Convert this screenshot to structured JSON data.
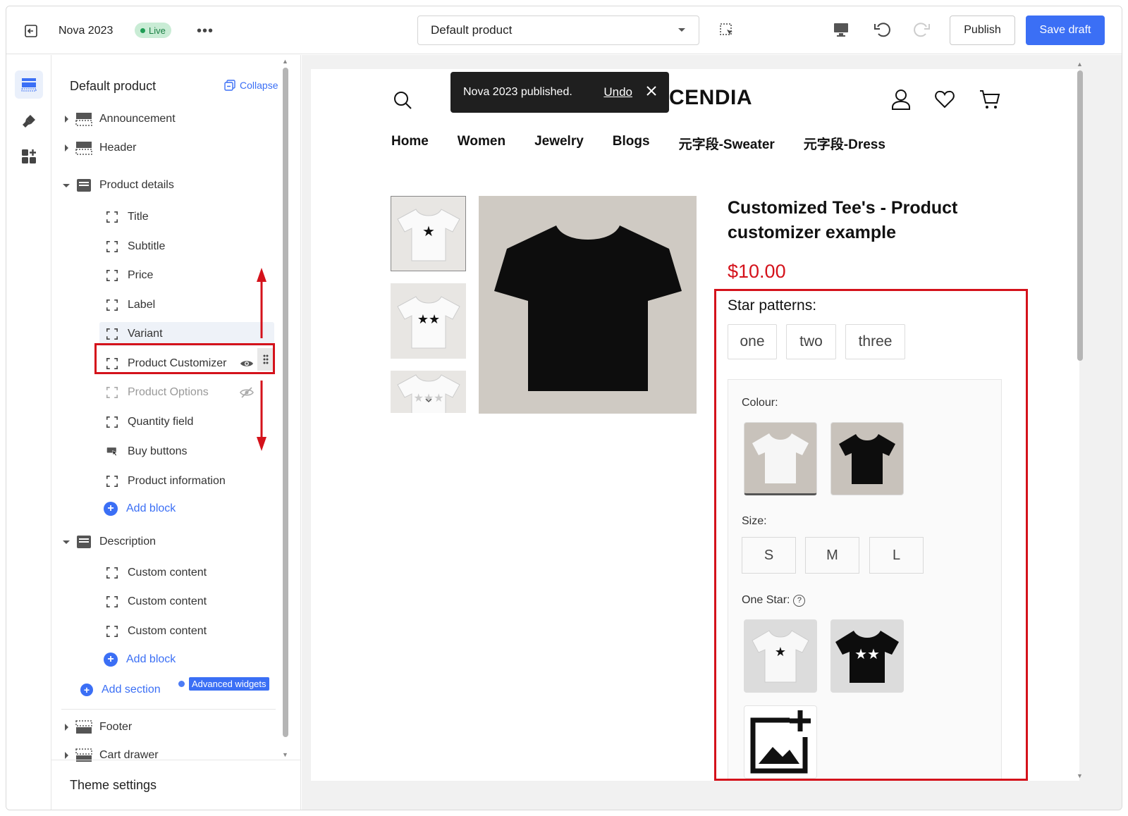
{
  "topbar": {
    "theme_name": "Nova 2023",
    "live_label": "Live",
    "more_label": "•••",
    "template_selected": "Default product",
    "publish_label": "Publish",
    "save_draft_label": "Save draft"
  },
  "sidebar": {
    "title": "Default product",
    "collapse_label": "Collapse",
    "sections": {
      "announcement": "Announcement",
      "header": "Header",
      "product_details": "Product details",
      "description": "Description",
      "footer": "Footer",
      "cart_drawer": "Cart drawer"
    },
    "product_blocks": [
      "Title",
      "Subtitle",
      "Price",
      "Label",
      "Variant",
      "Product Customizer",
      "Product Options",
      "Quantity field",
      "Buy buttons",
      "Product information"
    ],
    "description_blocks": [
      "Custom content",
      "Custom content",
      "Custom content"
    ],
    "add_block_label": "Add block",
    "add_section_label": "Add section",
    "advanced_widgets_label": "Advanced widgets",
    "theme_settings_label": "Theme settings"
  },
  "toast": {
    "message": "Nova 2023 published.",
    "undo_label": "Undo"
  },
  "store": {
    "logo": "CENDIA",
    "nav": [
      "Home",
      "Women",
      "Jewelry",
      "Blogs",
      "元字段-Sweater",
      "元字段-Dress"
    ]
  },
  "product": {
    "title": "Customized Tee's - Product customizer example",
    "price": "$10.00",
    "star_patterns_label": "Star patterns:",
    "patterns": [
      "one",
      "two",
      "three"
    ],
    "colour_label": "Colour:",
    "size_label": "Size:",
    "sizes": [
      "S",
      "M",
      "L"
    ],
    "one_star_label": "One Star:",
    "help_glyph": "?"
  },
  "colors": {
    "accent": "#3b6ff5",
    "highlight": "#d4121b",
    "live_bg": "#c9ecd5"
  }
}
